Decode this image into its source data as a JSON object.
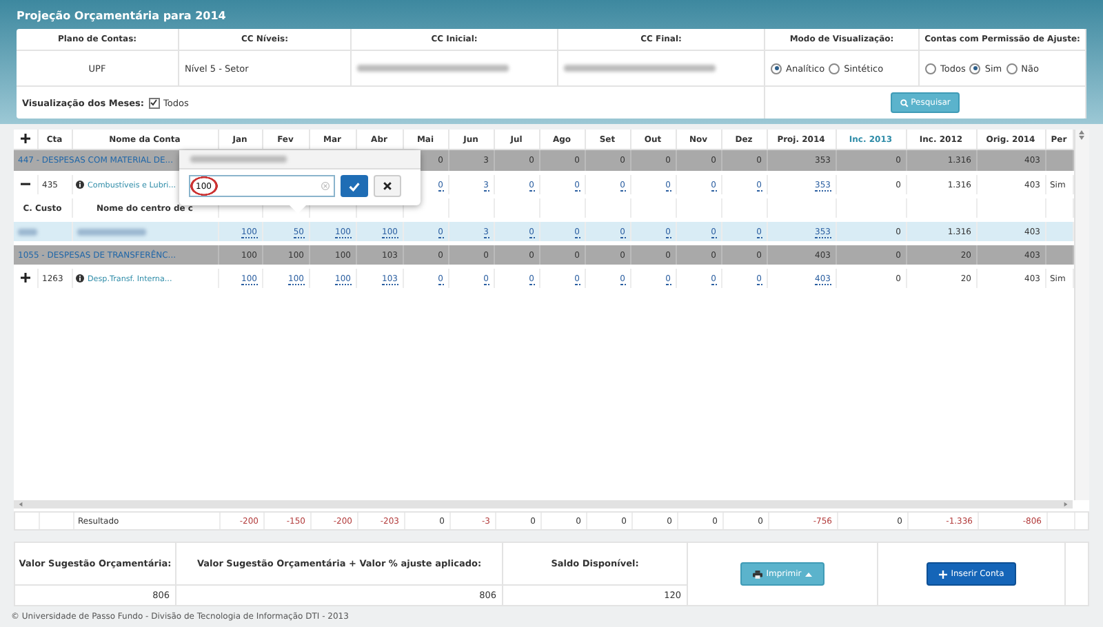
{
  "title": "Projeção Orçamentária para 2014",
  "filters": {
    "headers": [
      "Plano de Contas:",
      "CC Níveis:",
      "CC Inicial:",
      "CC Final:",
      "Modo de Visualização:",
      "Contas com Permissão de Ajuste:"
    ],
    "plano": "UPF",
    "niveis": "Nível 5 - Setor",
    "modo": [
      {
        "label": "Analítico",
        "selected": true
      },
      {
        "label": "Sintético",
        "selected": false
      }
    ],
    "permissao": [
      {
        "label": "Todos",
        "selected": false
      },
      {
        "label": "Sim",
        "selected": true
      },
      {
        "label": "Não",
        "selected": false
      }
    ],
    "months_label": "Visualização dos Meses:",
    "months_all": {
      "label": "Todos",
      "checked": true
    },
    "search_button": "Pesquisar"
  },
  "table": {
    "columns": [
      {
        "label": "Cta",
        "selected": false
      },
      {
        "label": "Nome da Conta",
        "selected": false
      },
      {
        "label": "Jan",
        "selected": false
      },
      {
        "label": "Fev",
        "selected": false
      },
      {
        "label": "Mar",
        "selected": false
      },
      {
        "label": "Abr",
        "selected": false
      },
      {
        "label": "Mai",
        "selected": false
      },
      {
        "label": "Jun",
        "selected": false
      },
      {
        "label": "Jul",
        "selected": false
      },
      {
        "label": "Ago",
        "selected": false
      },
      {
        "label": "Set",
        "selected": false
      },
      {
        "label": "Out",
        "selected": false
      },
      {
        "label": "Nov",
        "selected": false
      },
      {
        "label": "Dez",
        "selected": false
      },
      {
        "label": "Proj. 2014",
        "selected": false
      },
      {
        "label": "Inc. 2013",
        "selected": true
      },
      {
        "label": "Inc. 2012",
        "selected": false
      },
      {
        "label": "Orig. 2014",
        "selected": false
      },
      {
        "label": "Per",
        "selected": false
      }
    ],
    "rows": [
      {
        "kind": "group",
        "name": "447 - DESPESAS COM MATERIAL DE...",
        "values": [
          "0",
          "3",
          "0",
          "0",
          "0",
          "0",
          "0",
          "0",
          "353",
          "0",
          "1.316",
          "403"
        ]
      },
      {
        "kind": "account",
        "expanded": true,
        "code": "435",
        "name": "Combustíveis e Lubri...",
        "values": [
          "0",
          "3",
          "0",
          "0",
          "0",
          "0",
          "0",
          "0",
          "353",
          "0",
          "1.316",
          "403"
        ],
        "permission": "Sim"
      },
      {
        "kind": "cost_center_header",
        "code_label": "C. Custo",
        "name_label": "Nome do centro de c"
      },
      {
        "kind": "cost_center",
        "values": [
          "100",
          "50",
          "100",
          "100",
          "0",
          "3",
          "0",
          "0",
          "0",
          "0",
          "0",
          "0",
          "353",
          "0",
          "1.316",
          "403"
        ]
      },
      {
        "kind": "group",
        "name": "1055 - DESPESAS DE TRANSFERÊNC...",
        "values": [
          "100",
          "100",
          "100",
          "103",
          "0",
          "0",
          "0",
          "0",
          "0",
          "0",
          "0",
          "0",
          "403",
          "0",
          "20",
          "403"
        ]
      },
      {
        "kind": "account",
        "expanded": false,
        "code": "1263",
        "name": "Desp.Transf. Interna...",
        "values": [
          "100",
          "100",
          "100",
          "103",
          "0",
          "0",
          "0",
          "0",
          "0",
          "0",
          "0",
          "0",
          "403",
          "0",
          "20",
          "403"
        ],
        "permission": "Sim"
      }
    ],
    "result": {
      "label": "Resultado",
      "values": [
        {
          "text": "-200",
          "negative": true
        },
        {
          "text": "-150",
          "negative": true
        },
        {
          "text": "-200",
          "negative": true
        },
        {
          "text": "-203",
          "negative": true
        },
        {
          "text": "0",
          "negative": false
        },
        {
          "text": "-3",
          "negative": true
        },
        {
          "text": "0",
          "negative": false
        },
        {
          "text": "0",
          "negative": false
        },
        {
          "text": "0",
          "negative": false
        },
        {
          "text": "0",
          "negative": false
        },
        {
          "text": "0",
          "negative": false
        },
        {
          "text": "0",
          "negative": false
        },
        {
          "text": "-756",
          "negative": true
        },
        {
          "text": "0",
          "negative": false
        },
        {
          "text": "-1.336",
          "negative": true
        },
        {
          "text": "-806",
          "negative": true
        }
      ]
    }
  },
  "popover": {
    "value": "100"
  },
  "summary": [
    {
      "label": "Valor Sugestão Orçamentária:",
      "value": "806"
    },
    {
      "label": "Valor Sugestão Orçamentária + Valor % ajuste aplicado:",
      "value": "806"
    },
    {
      "label": "Saldo Disponível:",
      "value": "120"
    }
  ],
  "buttons": {
    "print": "Imprimir",
    "insert": "Inserir Conta"
  },
  "footer": "© Universidade de Passo Fundo - Divisão de Tecnologia de Informação DTI - 2013"
}
